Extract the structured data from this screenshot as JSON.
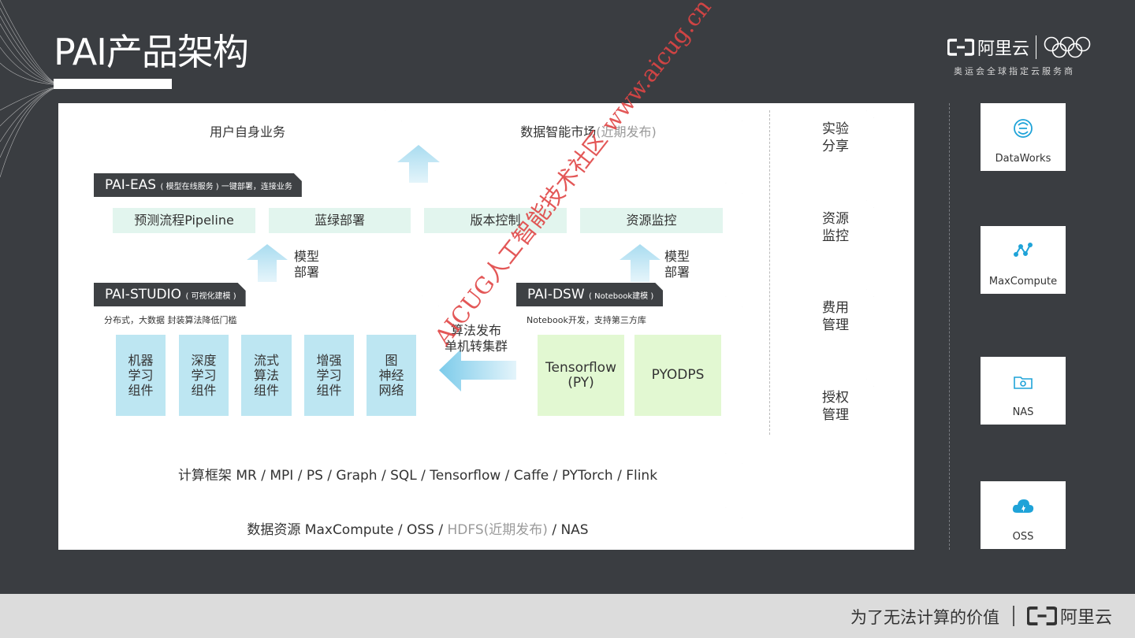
{
  "slide": {
    "title": "PAI产品架构",
    "logo_text": "阿里云",
    "logo_subtitle": "奥运会全球指定云服务商",
    "footer_slogan": "为了无法计算的价值",
    "footer_logo_text": "阿里云"
  },
  "diagram": {
    "top_left": "用户自身业务",
    "top_right_main": "数据智能市场",
    "top_right_note": "(近期发布)",
    "eas": {
      "tag_main": "PAI-EAS",
      "tag_note": "( 模型在线服务 ) 一键部署，连接业务",
      "items": [
        "预测流程Pipeline",
        "蓝绿部署",
        "版本控制",
        "资源监控"
      ]
    },
    "arrow_left_label": [
      "模型",
      "部署"
    ],
    "arrow_right_label": [
      "模型",
      "部署"
    ],
    "studio": {
      "tag_main": "PAI-STUDIO",
      "tag_note": "( 可视化建模 )",
      "desc": "分布式，大数据  封装算法降低门槛",
      "items": [
        [
          "机器",
          "学习",
          "组件"
        ],
        [
          "深度",
          "学习",
          "组件"
        ],
        [
          "流式",
          "算法",
          "组件"
        ],
        [
          "增强",
          "学习",
          "组件"
        ],
        [
          "图",
          "神经",
          "网络"
        ]
      ]
    },
    "middle_arrow_label": [
      "算法发布",
      "单机转集群"
    ],
    "dsw": {
      "tag_main": "PAI-DSW",
      "tag_note": "( Notebook建模 )",
      "desc": "Notebook开发，支持第三方库",
      "items": [
        [
          "Tensorflow",
          "(PY)"
        ],
        [
          "PYODPS"
        ]
      ]
    },
    "compute_row": "计算框架  MR / MPI / PS / Graph / SQL / Tensorflow / Caffe / PYTorch / Flink",
    "data_row_a": "数据资源 MaxCompute / OSS / ",
    "data_row_b": "HDFS(近期发布)",
    "data_row_c": " / NAS",
    "side_items": [
      [
        "实验",
        "分享"
      ],
      [
        "资源",
        "监控"
      ],
      [
        "费用",
        "管理"
      ],
      [
        "授权",
        "管理"
      ]
    ]
  },
  "services": [
    {
      "label": "DataWorks",
      "icon": "dataworks-icon"
    },
    {
      "label": "MaxCompute",
      "icon": "maxcompute-icon"
    },
    {
      "label": "NAS",
      "icon": "nas-icon"
    },
    {
      "label": "OSS",
      "icon": "oss-icon"
    }
  ],
  "watermark": "AICUG人工智能技术社区 www.aicug.cn",
  "colors": {
    "background": "#3a3d41",
    "accent_blue": "#1fa3d8",
    "pill_green": "#e2f5ee",
    "box_blue": "#bde6f2",
    "box_green": "#e2f8d2",
    "watermark": "#e04545"
  }
}
